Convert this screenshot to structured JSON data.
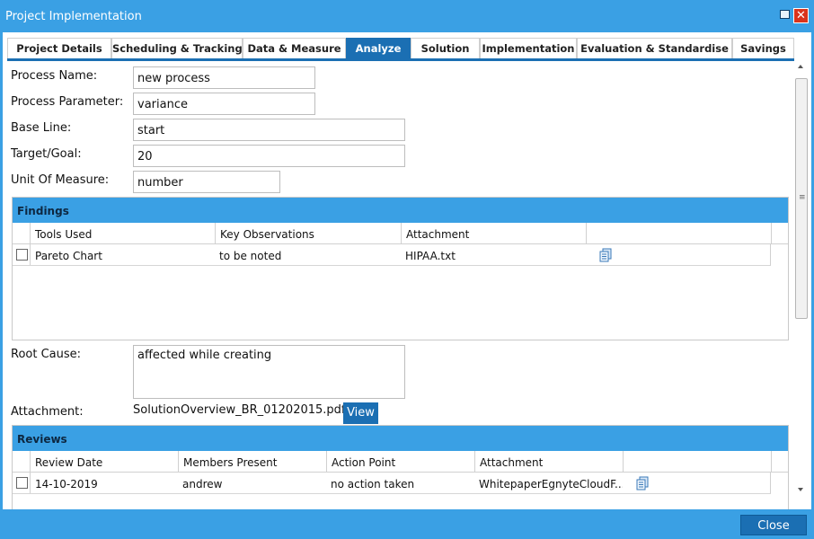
{
  "window": {
    "title": "Project Implementation",
    "close_glyph": "✕"
  },
  "tabs": [
    {
      "label": "Project Details",
      "active": false
    },
    {
      "label": "Scheduling & Tracking",
      "active": false
    },
    {
      "label": "Data & Measure",
      "active": false
    },
    {
      "label": "Analyze",
      "active": true
    },
    {
      "label": "Solution",
      "active": false
    },
    {
      "label": "Implementation",
      "active": false
    },
    {
      "label": "Evaluation & Standardise",
      "active": false
    },
    {
      "label": "Savings",
      "active": false
    }
  ],
  "form": {
    "process_name": {
      "label": "Process Name:",
      "value": "new process"
    },
    "process_parameter": {
      "label": "Process Parameter:",
      "value": "variance"
    },
    "base_line": {
      "label": "Base Line:",
      "value": "start"
    },
    "target_goal": {
      "label": "Target/Goal:",
      "value": "20"
    },
    "unit_of_measure": {
      "label": "Unit Of Measure:",
      "value": "number"
    },
    "root_cause": {
      "label": "Root Cause:",
      "value": "affected while creating"
    },
    "attachment": {
      "label": "Attachment:",
      "file": "SolutionOverview_BR_01202015.pdf",
      "view_label": "View"
    }
  },
  "findings": {
    "title": "Findings",
    "columns": [
      "Tools Used",
      "Key Observations",
      "Attachment"
    ],
    "rows": [
      {
        "tools_used": "Pareto Chart",
        "key_observations": "to be noted",
        "attachment": "HIPAA.txt",
        "icon": "document-icon"
      }
    ]
  },
  "reviews": {
    "title": "Reviews",
    "columns": [
      "Review Date",
      "Members Present",
      "Action Point",
      "Attachment"
    ],
    "rows": [
      {
        "review_date": "14-10-2019",
        "members_present": "andrew",
        "action_point": "no action taken",
        "attachment": "WhitepaperEgnyteCloudF...",
        "icon": "document-icon"
      }
    ]
  },
  "footer": {
    "close_label": "Close"
  },
  "scrollbar": {
    "grip": "≡"
  },
  "colors": {
    "accent": "#1b6fb3",
    "header_bar": "#3aa0e4"
  }
}
